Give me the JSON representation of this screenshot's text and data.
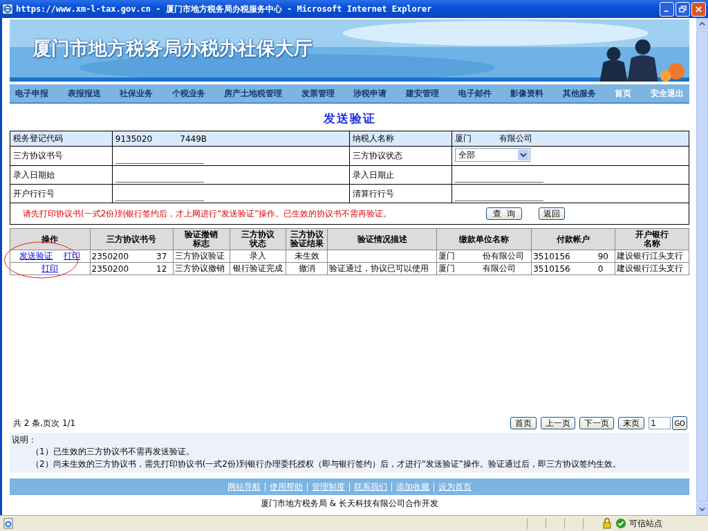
{
  "window": {
    "title": "https://www.xm-l-tax.gov.cn - 厦门市地方税务局办税服务中心 - Microsoft Internet Explorer"
  },
  "banner": {
    "title": "厦门市地方税务局办税办社保大厅"
  },
  "nav": [
    "电子申报",
    "表报报送",
    "社保业务",
    "个税业务",
    "房产土地税管理",
    "发票管理",
    "涉税申请",
    "建安管理",
    "电子邮件",
    "影像资料",
    "其他服务",
    "首页",
    "安全退出"
  ],
  "page_title": "发送验证",
  "form": {
    "rows": [
      [
        {
          "label": "税务登记代码",
          "kind": "text",
          "parts": [
            "9135020",
            "7449B"
          ]
        },
        {
          "label": "纳税人名称",
          "kind": "text",
          "parts": [
            "厦门",
            "有限公司"
          ]
        }
      ],
      [
        {
          "label": "三方协议书号",
          "kind": "input"
        },
        {
          "label": "三方协议状态",
          "kind": "select",
          "value": "全部"
        }
      ],
      [
        {
          "label": "录入日期始",
          "kind": "input"
        },
        {
          "label": "录入日期止",
          "kind": "input"
        }
      ],
      [
        {
          "label": "开户行行号",
          "kind": "input"
        },
        {
          "label": "清算行行号",
          "kind": "input"
        }
      ]
    ],
    "notice": "请先打印协议书(一式2份)到银行签约后，才上网进行“发送验证”操作。已生效的协议书不需再验证。",
    "buttons": [
      "查  询",
      "返回"
    ]
  },
  "table": {
    "columns": [
      "操作",
      "三方协议书号",
      "验证撤销标志",
      "三方协议状态",
      "三方协议验证结果",
      "验证情况描述",
      "缴款单位名称",
      "付款帐户",
      "开户银行名称"
    ],
    "rows": [
      {
        "cells": [
          {
            "links": [
              "发送验证",
              "打印"
            ]
          },
          {
            "parts": [
              "2350200",
              "37"
            ]
          },
          "三方协议验证",
          "录入",
          "未生效",
          "",
          {
            "parts": [
              "厦门",
              "份有限公司"
            ]
          },
          {
            "parts": [
              "3510156",
              "90"
            ]
          },
          "建设银行江头支行"
        ]
      },
      {
        "cells": [
          {
            "links": [
              "打印"
            ]
          },
          {
            "parts": [
              "2350200",
              "12"
            ]
          },
          "三方协议撤销",
          "银行验证完成",
          "撤消",
          "验证通过，协议已可以使用",
          {
            "parts": [
              "厦门",
              "有限公司"
            ]
          },
          {
            "parts": [
              "3510156",
              "0"
            ]
          },
          "建设银行江头支行"
        ]
      }
    ]
  },
  "pager": {
    "summary": "共 2 条,页次 1/1",
    "buttons": [
      "首页",
      "上一页",
      "下一页",
      "末页"
    ],
    "page": "1",
    "go": "GO"
  },
  "notes": {
    "title": "说明：",
    "items": [
      "（1）已生效的三方协议书不需再发送验证。",
      "（2）尚未生效的三方协议书，需先打印协议书(一式2份)到银行办理委托授权（即与银行签约）后，才进行“发送验证”操作。验证通过后，即三方协议签约生效。"
    ]
  },
  "footer": {
    "links": [
      "网站导航",
      "使用帮助",
      "管理制度",
      "联系我们",
      "添加收藏",
      "设为首页"
    ],
    "credit": "厦门市地方税务局 & 长天科技有限公司合作开发"
  },
  "status_bar": {
    "zone": "可信站点"
  }
}
